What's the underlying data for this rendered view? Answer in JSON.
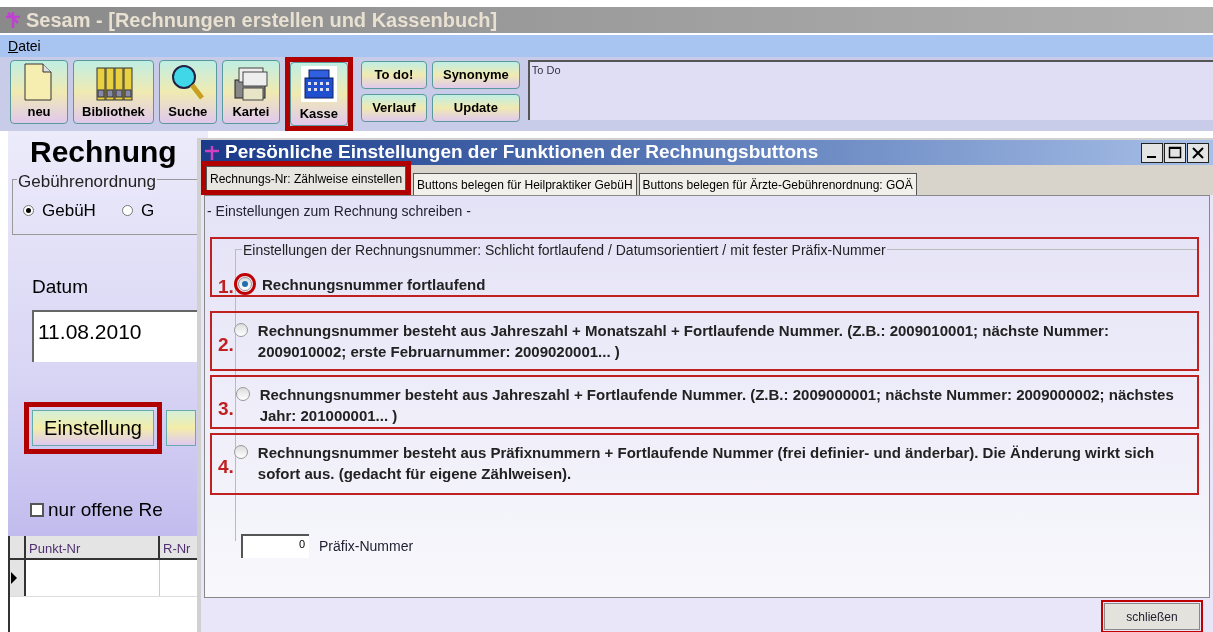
{
  "window": {
    "title": "Sesam - [Rechnungen erstellen und Kassenbuch]"
  },
  "menu": [
    {
      "label": "Datei"
    }
  ],
  "toolbar": {
    "big_buttons": [
      {
        "label": "neu",
        "kind": "page",
        "highlighted": false
      },
      {
        "label": "Bibliothek",
        "kind": "binders",
        "highlighted": false
      },
      {
        "label": "Suche",
        "kind": "magnifier",
        "highlighted": false
      },
      {
        "label": "Kartei",
        "kind": "cardfile",
        "highlighted": false
      },
      {
        "label": "Kasse",
        "kind": "register",
        "highlighted": true
      }
    ],
    "small_buttons": [
      {
        "label": "To do!"
      },
      {
        "label": "Synonyme"
      },
      {
        "label": "Verlauf"
      },
      {
        "label": "Update"
      }
    ],
    "todo": {
      "text": "To Do"
    }
  },
  "main": {
    "heading": "Rechnung",
    "fee_group": {
      "label": "Gebührenordnung",
      "options": [
        {
          "label": "GebüH",
          "selected": true
        },
        {
          "label": "G",
          "selected": false
        }
      ]
    },
    "date_label": "Datum",
    "date_value": "11.08.2010",
    "settings_button": {
      "label": "Einstellung",
      "highlighted": true
    },
    "open_only": {
      "label": "nur offene Re",
      "checked": false
    },
    "table": {
      "columns": [
        "Punkt-Nr",
        "R-Nr"
      ]
    }
  },
  "dialog": {
    "title": "Persönliche Einstellungen der Funktionen der Rechnungsbuttons",
    "tabs": [
      {
        "label": "Rechnungs-Nr: Zählweise einstellen",
        "selected": true,
        "highlighted": true
      },
      {
        "label": "Buttons belegen für Heilpraktiker GebüH",
        "selected": false,
        "highlighted": false
      },
      {
        "label": "Buttons belegen für Ärzte-Gebührenordnung: GOÄ",
        "selected": false,
        "highlighted": false
      }
    ],
    "section_label": "- Einstellungen zum Rechnung schreiben -",
    "group_label": "Einstellungen der Rechnungsnummer: Schlicht fortlaufend / Datumsorientiert / mit fester Präfix-Nummer",
    "options": [
      {
        "marker": "1.",
        "label": "Rechnungsnummer fortlaufend",
        "selected": true
      },
      {
        "marker": "2.",
        "label": "Rechnungsnummer besteht aus Jahreszahl + Monatszahl + Fortlaufende Nummer. (Z.B.: 2009010001; nächste Nummer: 2009010002; erste Februarnummer: 2009020001... )",
        "selected": false
      },
      {
        "marker": "3.",
        "label": "Rechnungsnummer besteht aus Jahreszahl + Fortlaufende Nummer. (Z.B.: 2009000001; nächste Nummer: 2009000002; nächstes Jahr: 201000001... )",
        "selected": false
      },
      {
        "marker": "4.",
        "label": "Rechnungsnummer besteht aus Präfixnummern +  Fortlaufende Nummer (frei definier- und änderbar). Die Änderung wirkt sich sofort aus. (gedacht für eigene Zählweisen).",
        "selected": false
      }
    ],
    "prefix": {
      "value": "0",
      "label": "Präfix-Nummer"
    },
    "close_button": {
      "label": "schließen",
      "highlighted": true
    }
  }
}
